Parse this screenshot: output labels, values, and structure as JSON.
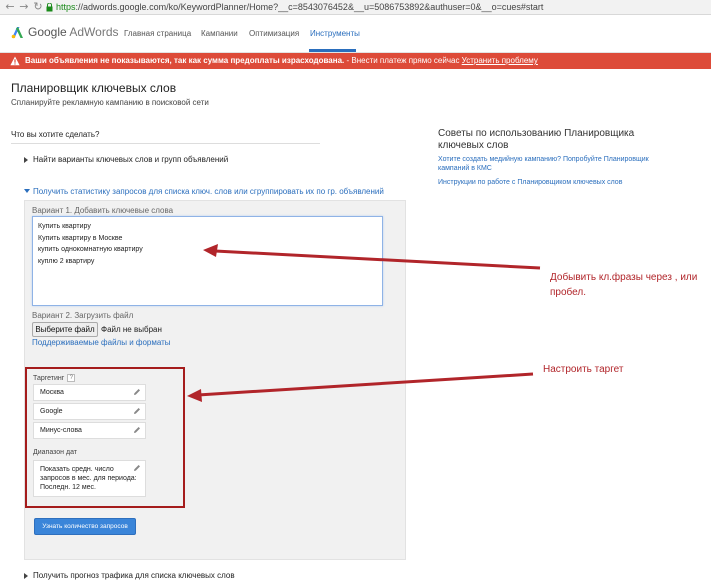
{
  "browser": {
    "url_scheme": "https",
    "url_rest": "://adwords.google.com/ko/KeywordPlanner/Home?__c=8543076452&__u=5086753892&authuser=0&__o=cues#start"
  },
  "header": {
    "logo_google": "Google",
    "logo_adwords": "AdWords",
    "tabs": [
      "Главная страница",
      "Кампании",
      "Оптимизация",
      "Инструменты"
    ],
    "active_tab": "Инструменты"
  },
  "alert": {
    "bold_text": "Ваши объявления не показываются, так как сумма предоплаты израсходована.",
    "text": " - Внести платеж прямо сейчас ",
    "link": "Устранить проблему"
  },
  "page": {
    "title": "Планировщик ключевых слов",
    "subtitle": "Спланируйте рекламную кампанию в поисковой сети",
    "question": "Что вы хотите сделать?",
    "option1": "Найти варианты ключевых слов и групп объявлений",
    "option2": "Получить статистику запросов для списка ключ. слов или сгруппировать их по гр. объявлений",
    "option3": "Получить прогноз трафика для списка ключевых слов"
  },
  "form": {
    "variant1_label": "Вариант 1. Добавить ключевые слова",
    "keywords": [
      "Купить квартиру",
      "Купить квартиру в Москве",
      "купить однокомнатную квартиру",
      "куплю 2 квартиру"
    ],
    "variant2_label": "Вариант 2. Загрузить файл",
    "file_button": "Выберите файл",
    "file_status": "Файл не выбран",
    "formats_link": "Поддерживаемые файлы и форматы",
    "targeting_label": "Таргетинг",
    "help_mark": "?",
    "location": "Москва",
    "network": "Google",
    "negatives": "Минус-слова",
    "date_label": "Диапазон дат",
    "date_value": "Показать средн. число запросов в мес. для периода: Последн. 12 мес.",
    "submit": "Узнать количество запросов"
  },
  "tips": {
    "title": "Советы по использованию Планировщика ключевых слов",
    "link1": "Хотите создать медийную кампанию? Попробуйте Планировщик кампаний в КМС",
    "link2": "Инструкции по работе с Планировщиком ключевых слов"
  },
  "annotations": {
    "keywords_note": "Добывить кл.фразы через , или пробел.",
    "targeting_note": "Настроить таргет"
  },
  "colors": {
    "alert": "#dd4b39",
    "link": "#2a6ebd",
    "annotation": "#b1252a",
    "button": "#3a85d9"
  }
}
